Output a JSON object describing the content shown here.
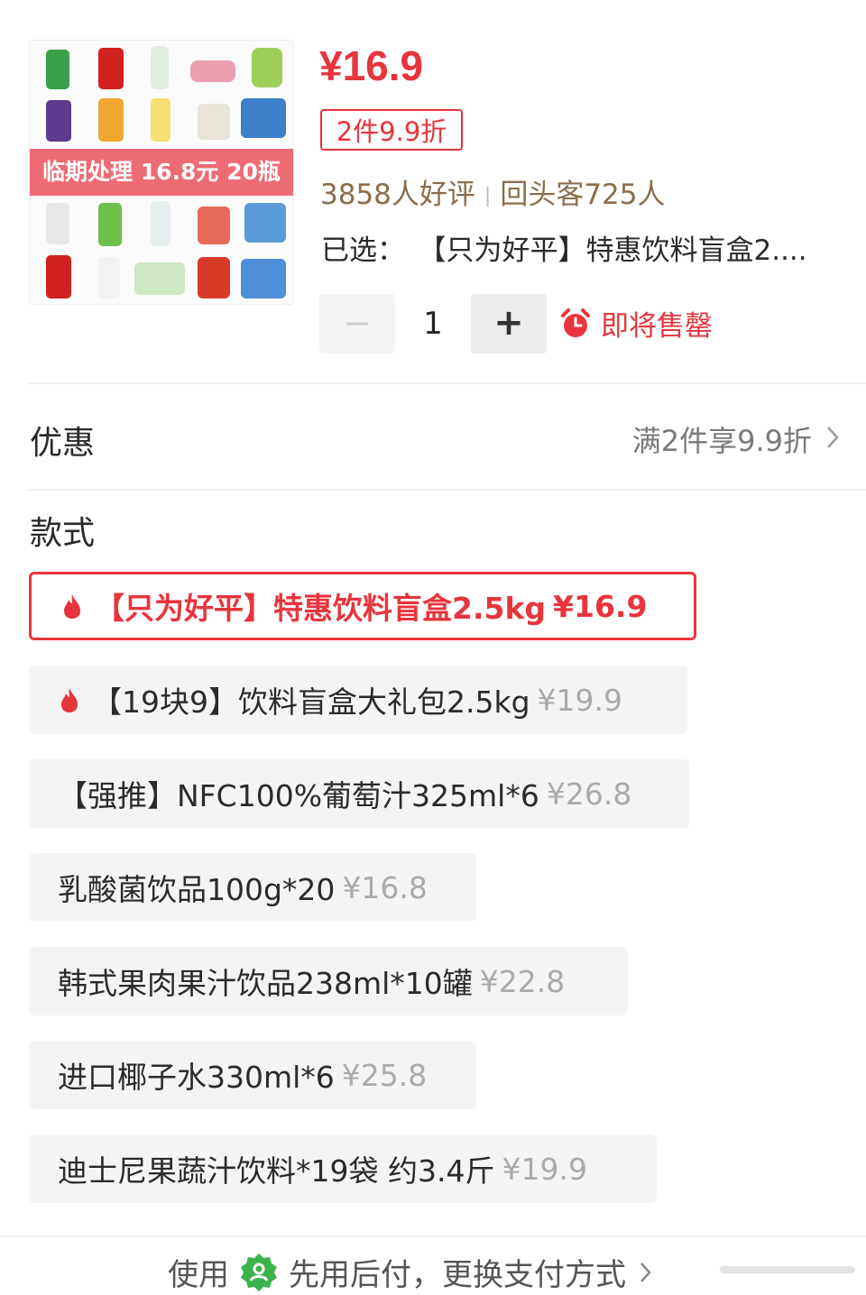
{
  "product": {
    "image_banner": "临期处理 16.8元 20瓶",
    "price": "¥16.9",
    "promo_tag": "2件9.9折",
    "reviews": "3858人好评",
    "repeat_customers": "回头客725人",
    "selected_label": "已选：",
    "selected_value": "【只为好平】特惠饮料盲盒2....",
    "quantity": "1",
    "minus_label": "−",
    "plus_label": "+",
    "stock_status": "即将售罄"
  },
  "discount": {
    "title": "优惠",
    "value": "满2件享9.9折"
  },
  "styles": {
    "title": "款式",
    "options": [
      {
        "name": "【只为好平】特惠饮料盲盒2.5kg",
        "price": "¥16.9",
        "hot": true,
        "selected": true
      },
      {
        "name": "【19块9】饮料盲盒大礼包2.5kg",
        "price": "¥19.9",
        "hot": true,
        "selected": false
      },
      {
        "name": "【强推】NFC100%葡萄汁325ml*6",
        "price": "¥26.8",
        "hot": false,
        "selected": false
      },
      {
        "name": "乳酸菌饮品100g*20",
        "price": "¥16.8",
        "hot": false,
        "selected": false
      },
      {
        "name": "韩式果肉果汁饮品238ml*10罐",
        "price": "¥22.8",
        "hot": false,
        "selected": false
      },
      {
        "name": "进口椰子水330ml*6",
        "price": "¥25.8",
        "hot": false,
        "selected": false
      },
      {
        "name": "迪士尼果蔬汁饮料*19袋 约3.4斤",
        "price": "¥19.9",
        "hot": false,
        "selected": false
      }
    ]
  },
  "footer": {
    "use_label": "使用",
    "pay_text": "先用后付，更换支付方式"
  },
  "colors": {
    "accent": "#e8343c",
    "review_text": "#8a6d4b",
    "pay_icon": "#3bb34a"
  },
  "icons": [
    "alarm-clock-icon",
    "fire-icon",
    "chevron-right-icon",
    "pay-later-icon"
  ]
}
